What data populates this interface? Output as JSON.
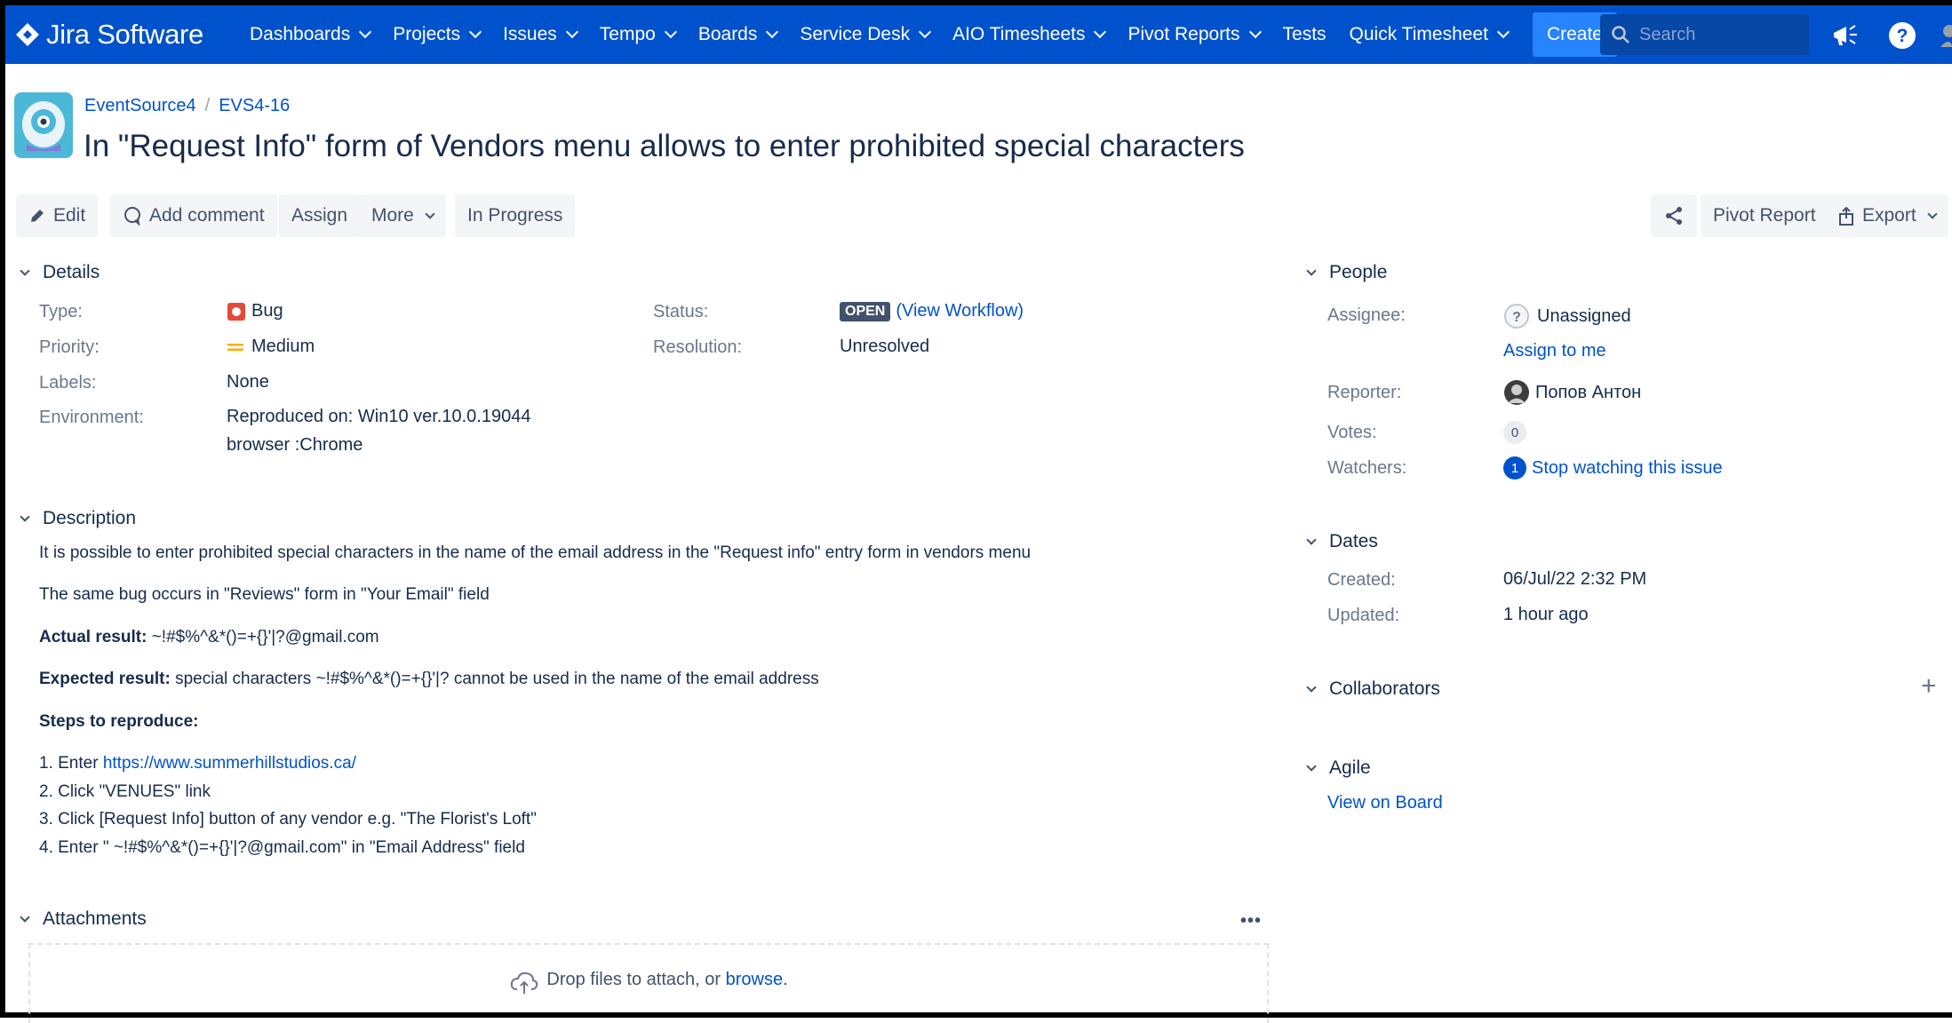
{
  "nav": {
    "logo_text": "Jira Software",
    "items": [
      {
        "label": "Dashboards",
        "dropdown": true
      },
      {
        "label": "Projects",
        "dropdown": true
      },
      {
        "label": "Issues",
        "dropdown": true
      },
      {
        "label": "Tempo",
        "dropdown": true
      },
      {
        "label": "Boards",
        "dropdown": true
      },
      {
        "label": "Service Desk",
        "dropdown": true
      },
      {
        "label": "AIO Timesheets",
        "dropdown": true
      },
      {
        "label": "Pivot Reports",
        "dropdown": true
      },
      {
        "label": "Tests",
        "dropdown": false
      },
      {
        "label": "Quick Timesheet",
        "dropdown": true
      }
    ],
    "create_label": "Create",
    "search_placeholder": "Search",
    "colors": {
      "bar": "#0052cc",
      "create": "#2684ff"
    }
  },
  "header": {
    "project": "EventSource4",
    "issue_key": "EVS4-16",
    "title": "In \"Request Info\" form of Vendors menu allows to enter prohibited special characters"
  },
  "toolbar": {
    "edit": "Edit",
    "add_comment": "Add comment",
    "assign": "Assign",
    "more": "More",
    "in_progress": "In Progress",
    "pivot_report": "Pivot Report",
    "export": "Export"
  },
  "details": {
    "heading": "Details",
    "type_label": "Type:",
    "type_value": "Bug",
    "priority_label": "Priority:",
    "priority_value": "Medium",
    "labels_label": "Labels:",
    "labels_value": "None",
    "environment_label": "Environment:",
    "environment_line1": "Reproduced on: Win10 ver.10.0.19044",
    "environment_line2": "browser :Chrome",
    "status_label": "Status:",
    "status_value": "OPEN",
    "view_workflow": "(View Workflow)",
    "resolution_label": "Resolution:",
    "resolution_value": "Unresolved"
  },
  "description": {
    "heading": "Description",
    "line1": "It is possible to enter prohibited special characters in the name of the email address in the \"Request info\" entry form in vendors menu",
    "line2": "The same bug occurs in \"Reviews\" form in \"Your Email\" field",
    "actual_label": "Actual result:",
    "actual_value": " ~!#$%^&*()=+{}'|?@gmail.com",
    "expected_label": "Expected result:",
    "expected_value": "  special characters ~!#$%^&*()=+{}'|? cannot be used in the name of the email address",
    "steps_label": "Steps to reproduce:",
    "step1_prefix": "1. Enter ",
    "step1_link": "https://www.summerhillstudios.ca/",
    "step2": "2. Click \"VENUES\" link",
    "step3": "3. Click [Request Info] button of  any vendor e.g. \"The Florist's Loft\"",
    "step4": "4. Enter \" ~!#$%^&*()=+{}'|?@gmail.com\" in \"Email Address\" field"
  },
  "attachments": {
    "heading": "Attachments",
    "drop_text": "Drop files to attach, or ",
    "browse": "browse."
  },
  "people": {
    "heading": "People",
    "assignee_label": "Assignee:",
    "assignee_value": "Unassigned",
    "assign_to_me": "Assign to me",
    "reporter_label": "Reporter:",
    "reporter_value": "Попов Антон",
    "votes_label": "Votes:",
    "votes_value": "0",
    "watchers_label": "Watchers:",
    "watchers_count": "1",
    "watchers_action": "Stop watching this issue"
  },
  "dates": {
    "heading": "Dates",
    "created_label": "Created:",
    "created_value": "06/Jul/22 2:32 PM",
    "updated_label": "Updated:",
    "updated_value": "1 hour ago"
  },
  "collaborators": {
    "heading": "Collaborators"
  },
  "agile": {
    "heading": "Agile",
    "view_on_board": "View on Board"
  }
}
